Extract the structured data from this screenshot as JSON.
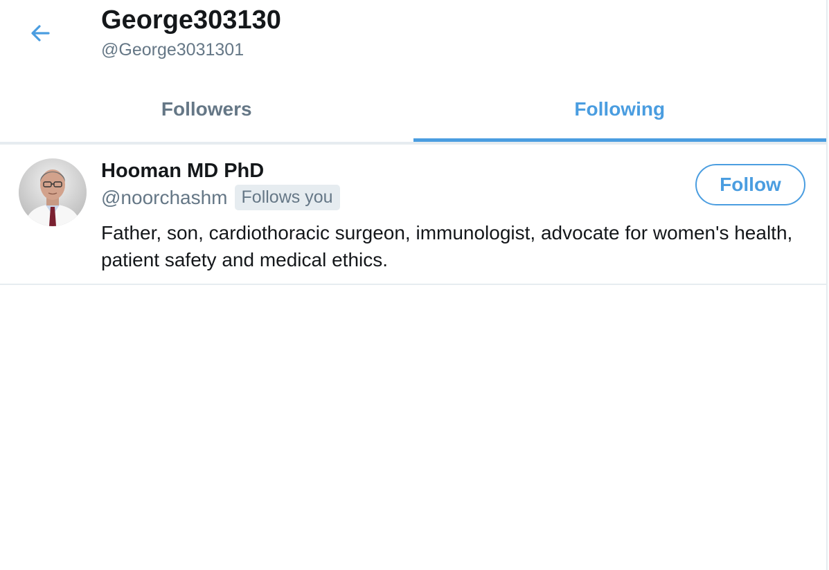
{
  "header": {
    "title": "George303130",
    "handle": "@George3031301",
    "back_icon": "arrow-left-icon"
  },
  "tabs": [
    {
      "label": "Followers",
      "active": false
    },
    {
      "label": "Following",
      "active": true
    }
  ],
  "colors": {
    "accent": "#4a9de0",
    "muted_text": "#657786",
    "divider": "#e6ecf0",
    "primary_text": "#14171a"
  },
  "users": [
    {
      "name": "Hooman MD PhD",
      "handle": "@noorchashm",
      "badge": "Follows you",
      "follow_label": "Follow",
      "bio": "Father, son, cardiothoracic surgeon, immunologist, advocate for women's health, patient safety and medical ethics."
    }
  ]
}
